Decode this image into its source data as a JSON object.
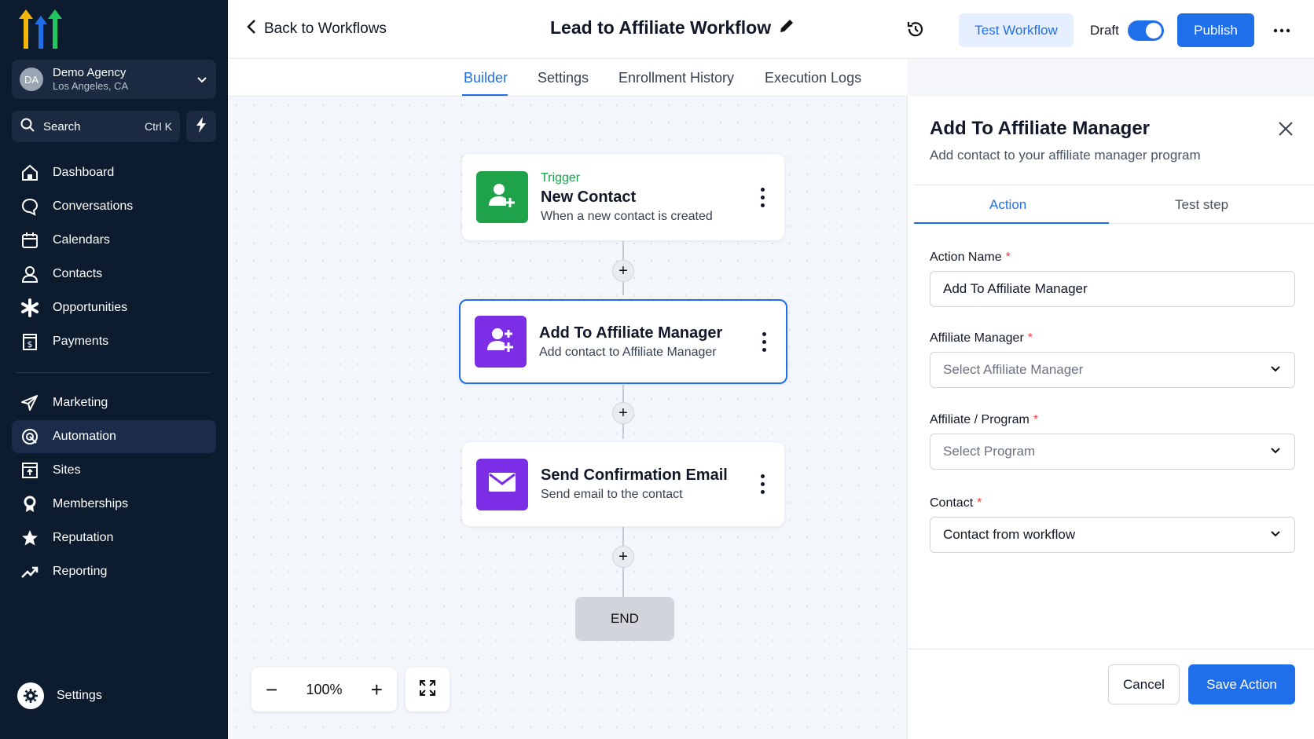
{
  "sidebar": {
    "account": {
      "initials": "DA",
      "name": "Demo Agency",
      "location": "Los Angeles, CA"
    },
    "search": {
      "label": "Search",
      "shortcut": "Ctrl K"
    },
    "items_primary": [
      {
        "label": "Dashboard",
        "icon": "home-icon"
      },
      {
        "label": "Conversations",
        "icon": "chat-icon"
      },
      {
        "label": "Calendars",
        "icon": "calendar-icon"
      },
      {
        "label": "Contacts",
        "icon": "user-icon"
      },
      {
        "label": "Opportunities",
        "icon": "asterisk-icon"
      },
      {
        "label": "Payments",
        "icon": "invoice-icon"
      }
    ],
    "items_secondary": [
      {
        "label": "Marketing",
        "icon": "send-icon"
      },
      {
        "label": "Automation",
        "icon": "automation-icon",
        "active": true
      },
      {
        "label": "Sites",
        "icon": "sites-icon"
      },
      {
        "label": "Memberships",
        "icon": "badge-icon"
      },
      {
        "label": "Reputation",
        "icon": "star-icon"
      },
      {
        "label": "Reporting",
        "icon": "trend-icon"
      }
    ],
    "settings_label": "Settings"
  },
  "header": {
    "back_label": "Back to Workflows",
    "workflow_title": "Lead to Affiliate Workflow",
    "test_label": "Test Workflow",
    "draft_label": "Draft",
    "publish_label": "Publish"
  },
  "tabs": [
    {
      "label": "Builder",
      "active": true
    },
    {
      "label": "Settings"
    },
    {
      "label": "Enrollment History"
    },
    {
      "label": "Execution Logs"
    }
  ],
  "canvas": {
    "trigger": {
      "eyebrow": "Trigger",
      "title": "New Contact",
      "subtitle": "When a new contact is created",
      "color": "#1fa34a"
    },
    "action1": {
      "title": "Add To Affiliate Manager",
      "subtitle": "Add contact to Affiliate Manager",
      "color": "#7c2ee6"
    },
    "action2": {
      "title": "Send Confirmation Email",
      "subtitle": "Send email to the contact",
      "color": "#7c2ee6"
    },
    "end_label": "END",
    "zoom": "100%"
  },
  "panel": {
    "title": "Add To Affiliate Manager",
    "subtitle": "Add contact to your affiliate manager program",
    "tabs": {
      "action": "Action",
      "test": "Test step"
    },
    "fields": {
      "action_name": {
        "label": "Action Name",
        "value": "Add To Affiliate Manager"
      },
      "affiliate_manager": {
        "label": "Affiliate Manager",
        "placeholder": "Select Affiliate Manager"
      },
      "program": {
        "label": "Affiliate / Program",
        "placeholder": "Select Program"
      },
      "contact": {
        "label": "Contact",
        "value": "Contact from workflow"
      }
    },
    "cancel_label": "Cancel",
    "save_label": "Save Action"
  },
  "colors": {
    "accent": "#1f6feb",
    "sidebar": "#0d1b2e",
    "required": "#ef4444"
  }
}
